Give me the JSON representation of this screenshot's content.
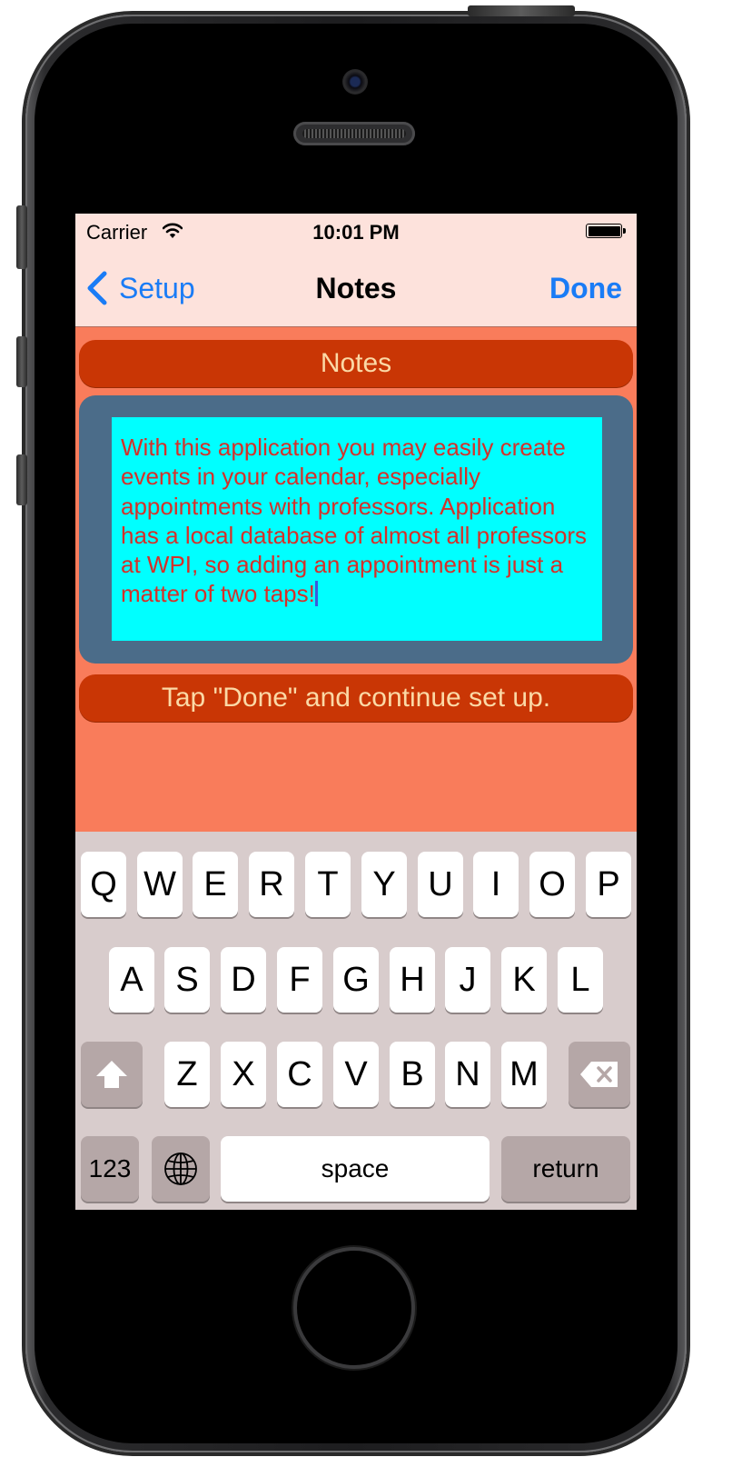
{
  "status_bar": {
    "carrier": "Carrier",
    "time": "10:01 PM"
  },
  "nav": {
    "back_label": "Setup",
    "title": "Notes",
    "done_label": "Done"
  },
  "section_title": "Notes",
  "notes_text": "With this application you may easily create events in your calendar, especially appointments with professors. Application has a local database of almost all professors at WPI, so adding an appointment is just a matter of two taps!",
  "instruction": "Tap \"Done\" and continue set up.",
  "keyboard": {
    "row1": [
      "Q",
      "W",
      "E",
      "R",
      "T",
      "Y",
      "U",
      "I",
      "O",
      "P"
    ],
    "row2": [
      "A",
      "S",
      "D",
      "F",
      "G",
      "H",
      "J",
      "K",
      "L"
    ],
    "row3": [
      "Z",
      "X",
      "C",
      "V",
      "B",
      "N",
      "M"
    ],
    "numbers_label": "123",
    "space_label": "space",
    "return_label": "return"
  },
  "colors": {
    "screen_background": "#f97c5b",
    "bar_background": "#fde2dc",
    "accent_blue": "#1a7cf6",
    "pill_background": "#c93605",
    "pill_text": "#fbd9a6",
    "card_background": "#4b6c89",
    "textview_background": "#00ffff",
    "textview_text": "#d4312a",
    "keyboard_background": "#d8cccc"
  },
  "icons": [
    "wifi-icon",
    "battery-icon",
    "chevron-left-icon",
    "shift-icon",
    "delete-icon",
    "globe-icon"
  ]
}
